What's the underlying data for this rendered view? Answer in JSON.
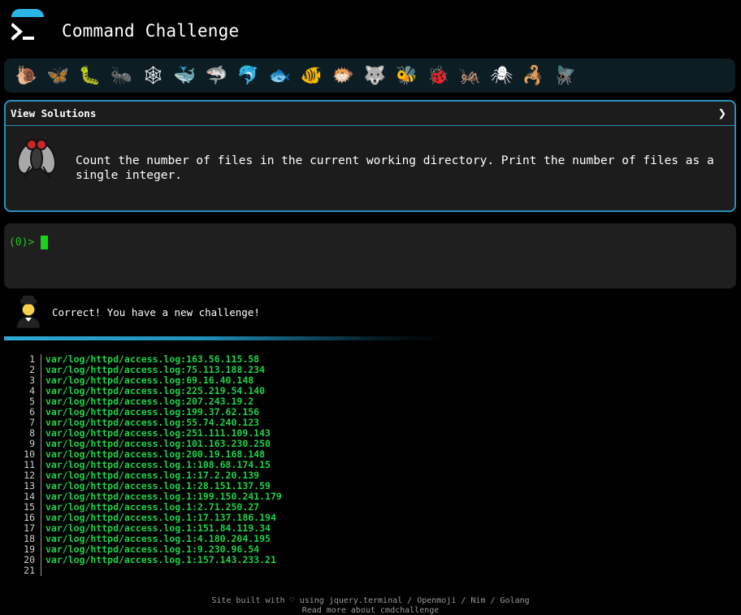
{
  "header": {
    "title": "Command Challenge"
  },
  "iconbar": {
    "icons": [
      {
        "name": "snail-icon",
        "glyph": "🐌"
      },
      {
        "name": "butterfly-icon",
        "glyph": "🦋"
      },
      {
        "name": "caterpillar-icon",
        "glyph": "🐛"
      },
      {
        "name": "ant-icon",
        "glyph": "🐜"
      },
      {
        "name": "spider-web-icon",
        "glyph": "🕸"
      },
      {
        "name": "whale-icon",
        "glyph": "🐳"
      },
      {
        "name": "shark-icon",
        "glyph": "🦈"
      },
      {
        "name": "dolphin-icon",
        "glyph": "🐬"
      },
      {
        "name": "fish-icon",
        "glyph": "🐟"
      },
      {
        "name": "tropical-fish-icon",
        "glyph": "🐠"
      },
      {
        "name": "blowfish-icon",
        "glyph": "🐡"
      },
      {
        "name": "wolf-icon",
        "glyph": "🐺"
      },
      {
        "name": "bee-icon",
        "glyph": "🐝"
      },
      {
        "name": "ladybug-icon",
        "glyph": "🐞"
      },
      {
        "name": "cricket-icon",
        "glyph": "🦗"
      },
      {
        "name": "spider-icon",
        "glyph": "🕷"
      },
      {
        "name": "scorpion-icon",
        "glyph": "🦂"
      },
      {
        "name": "fly-icon",
        "glyph": "🪰"
      }
    ]
  },
  "challenge": {
    "header_label": "View Solutions",
    "chevron": "❯",
    "description": "Count the number of files in the current working directory. Print the number of files as a single integer."
  },
  "terminal": {
    "prompt": "(0)>"
  },
  "status": {
    "message": "Correct! You have a new challenge!"
  },
  "output": {
    "lines": [
      {
        "n": "1",
        "text": "var/log/httpd/access.log:163.56.115.58"
      },
      {
        "n": "2",
        "text": "var/log/httpd/access.log:75.113.188.234"
      },
      {
        "n": "3",
        "text": "var/log/httpd/access.log:69.16.40.148"
      },
      {
        "n": "4",
        "text": "var/log/httpd/access.log:225.219.54.140"
      },
      {
        "n": "5",
        "text": "var/log/httpd/access.log:207.243.19.2"
      },
      {
        "n": "6",
        "text": "var/log/httpd/access.log:199.37.62.156"
      },
      {
        "n": "7",
        "text": "var/log/httpd/access.log:55.74.240.123"
      },
      {
        "n": "8",
        "text": "var/log/httpd/access.log:251.111.109.143"
      },
      {
        "n": "9",
        "text": "var/log/httpd/access.log:101.163.230.250"
      },
      {
        "n": "10",
        "text": "var/log/httpd/access.log:200.19.168.148"
      },
      {
        "n": "11",
        "text": "var/log/httpd/access.log.1:108.68.174.15"
      },
      {
        "n": "12",
        "text": "var/log/httpd/access.log.1:17.2.20.139"
      },
      {
        "n": "13",
        "text": "var/log/httpd/access.log.1:28.151.137.59"
      },
      {
        "n": "14",
        "text": "var/log/httpd/access.log.1:199.150.241.179"
      },
      {
        "n": "15",
        "text": "var/log/httpd/access.log.1:2.71.250.27"
      },
      {
        "n": "16",
        "text": "var/log/httpd/access.log.1:17.137.186.194"
      },
      {
        "n": "17",
        "text": "var/log/httpd/access.log.1:151.84.119.34"
      },
      {
        "n": "18",
        "text": "var/log/httpd/access.log.1:4.180.204.195"
      },
      {
        "n": "19",
        "text": "var/log/httpd/access.log.1:9.230.96.54"
      },
      {
        "n": "20",
        "text": "var/log/httpd/access.log.1:157.143.233.21"
      },
      {
        "n": "21",
        "text": ""
      }
    ]
  },
  "footer": {
    "line1": "Site built with ♡ using jquery.terminal / Openmoji / Nim / Golang",
    "line2": "Read more about cmdchallenge"
  },
  "colors": {
    "accent": "#2a8fb6",
    "terminal_green": "#1fd14a",
    "cursor": "#19d219"
  }
}
